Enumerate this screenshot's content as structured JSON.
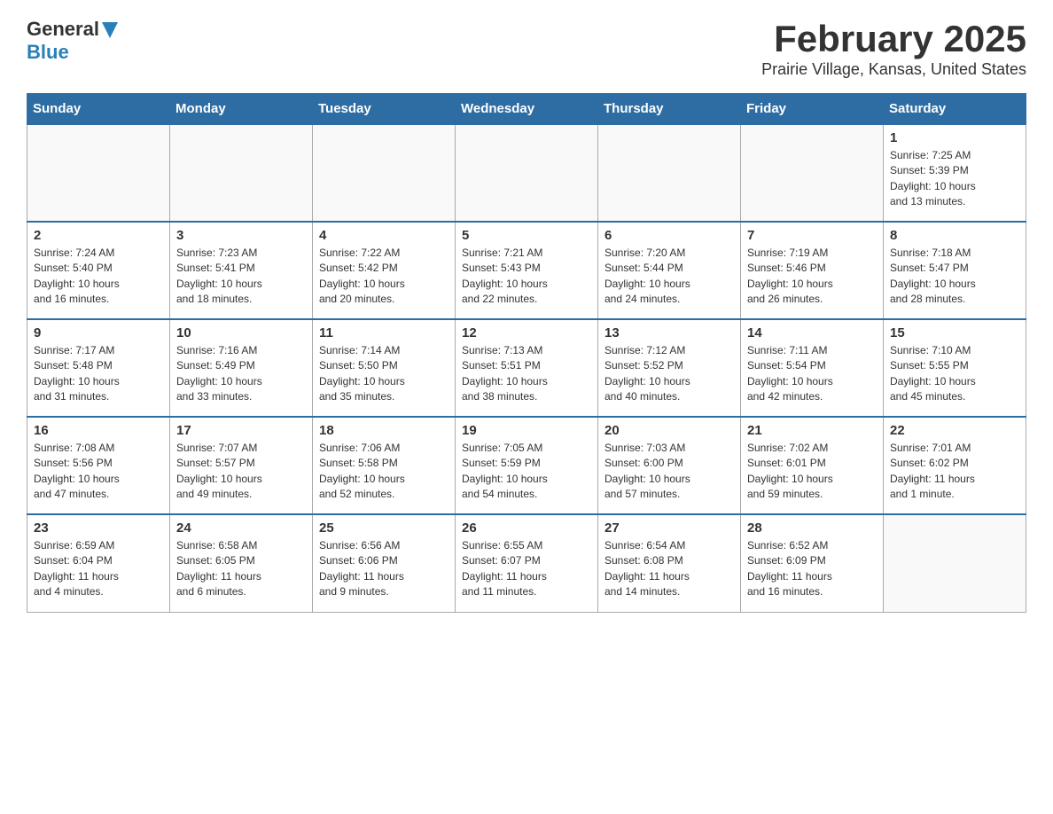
{
  "header": {
    "logo_general": "General",
    "logo_blue": "Blue",
    "month_title": "February 2025",
    "location": "Prairie Village, Kansas, United States"
  },
  "weekdays": [
    "Sunday",
    "Monday",
    "Tuesday",
    "Wednesday",
    "Thursday",
    "Friday",
    "Saturday"
  ],
  "weeks": [
    [
      {
        "day": "",
        "info": ""
      },
      {
        "day": "",
        "info": ""
      },
      {
        "day": "",
        "info": ""
      },
      {
        "day": "",
        "info": ""
      },
      {
        "day": "",
        "info": ""
      },
      {
        "day": "",
        "info": ""
      },
      {
        "day": "1",
        "info": "Sunrise: 7:25 AM\nSunset: 5:39 PM\nDaylight: 10 hours\nand 13 minutes."
      }
    ],
    [
      {
        "day": "2",
        "info": "Sunrise: 7:24 AM\nSunset: 5:40 PM\nDaylight: 10 hours\nand 16 minutes."
      },
      {
        "day": "3",
        "info": "Sunrise: 7:23 AM\nSunset: 5:41 PM\nDaylight: 10 hours\nand 18 minutes."
      },
      {
        "day": "4",
        "info": "Sunrise: 7:22 AM\nSunset: 5:42 PM\nDaylight: 10 hours\nand 20 minutes."
      },
      {
        "day": "5",
        "info": "Sunrise: 7:21 AM\nSunset: 5:43 PM\nDaylight: 10 hours\nand 22 minutes."
      },
      {
        "day": "6",
        "info": "Sunrise: 7:20 AM\nSunset: 5:44 PM\nDaylight: 10 hours\nand 24 minutes."
      },
      {
        "day": "7",
        "info": "Sunrise: 7:19 AM\nSunset: 5:46 PM\nDaylight: 10 hours\nand 26 minutes."
      },
      {
        "day": "8",
        "info": "Sunrise: 7:18 AM\nSunset: 5:47 PM\nDaylight: 10 hours\nand 28 minutes."
      }
    ],
    [
      {
        "day": "9",
        "info": "Sunrise: 7:17 AM\nSunset: 5:48 PM\nDaylight: 10 hours\nand 31 minutes."
      },
      {
        "day": "10",
        "info": "Sunrise: 7:16 AM\nSunset: 5:49 PM\nDaylight: 10 hours\nand 33 minutes."
      },
      {
        "day": "11",
        "info": "Sunrise: 7:14 AM\nSunset: 5:50 PM\nDaylight: 10 hours\nand 35 minutes."
      },
      {
        "day": "12",
        "info": "Sunrise: 7:13 AM\nSunset: 5:51 PM\nDaylight: 10 hours\nand 38 minutes."
      },
      {
        "day": "13",
        "info": "Sunrise: 7:12 AM\nSunset: 5:52 PM\nDaylight: 10 hours\nand 40 minutes."
      },
      {
        "day": "14",
        "info": "Sunrise: 7:11 AM\nSunset: 5:54 PM\nDaylight: 10 hours\nand 42 minutes."
      },
      {
        "day": "15",
        "info": "Sunrise: 7:10 AM\nSunset: 5:55 PM\nDaylight: 10 hours\nand 45 minutes."
      }
    ],
    [
      {
        "day": "16",
        "info": "Sunrise: 7:08 AM\nSunset: 5:56 PM\nDaylight: 10 hours\nand 47 minutes."
      },
      {
        "day": "17",
        "info": "Sunrise: 7:07 AM\nSunset: 5:57 PM\nDaylight: 10 hours\nand 49 minutes."
      },
      {
        "day": "18",
        "info": "Sunrise: 7:06 AM\nSunset: 5:58 PM\nDaylight: 10 hours\nand 52 minutes."
      },
      {
        "day": "19",
        "info": "Sunrise: 7:05 AM\nSunset: 5:59 PM\nDaylight: 10 hours\nand 54 minutes."
      },
      {
        "day": "20",
        "info": "Sunrise: 7:03 AM\nSunset: 6:00 PM\nDaylight: 10 hours\nand 57 minutes."
      },
      {
        "day": "21",
        "info": "Sunrise: 7:02 AM\nSunset: 6:01 PM\nDaylight: 10 hours\nand 59 minutes."
      },
      {
        "day": "22",
        "info": "Sunrise: 7:01 AM\nSunset: 6:02 PM\nDaylight: 11 hours\nand 1 minute."
      }
    ],
    [
      {
        "day": "23",
        "info": "Sunrise: 6:59 AM\nSunset: 6:04 PM\nDaylight: 11 hours\nand 4 minutes."
      },
      {
        "day": "24",
        "info": "Sunrise: 6:58 AM\nSunset: 6:05 PM\nDaylight: 11 hours\nand 6 minutes."
      },
      {
        "day": "25",
        "info": "Sunrise: 6:56 AM\nSunset: 6:06 PM\nDaylight: 11 hours\nand 9 minutes."
      },
      {
        "day": "26",
        "info": "Sunrise: 6:55 AM\nSunset: 6:07 PM\nDaylight: 11 hours\nand 11 minutes."
      },
      {
        "day": "27",
        "info": "Sunrise: 6:54 AM\nSunset: 6:08 PM\nDaylight: 11 hours\nand 14 minutes."
      },
      {
        "day": "28",
        "info": "Sunrise: 6:52 AM\nSunset: 6:09 PM\nDaylight: 11 hours\nand 16 minutes."
      },
      {
        "day": "",
        "info": ""
      }
    ]
  ]
}
